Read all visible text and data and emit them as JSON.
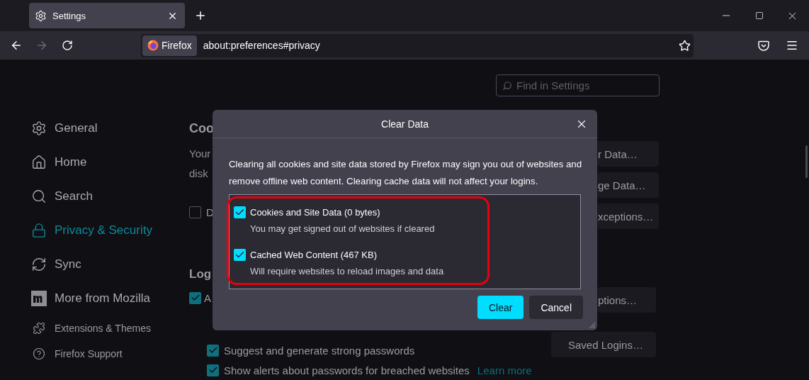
{
  "tab": {
    "title": "Settings",
    "selected": true
  },
  "address_bar": {
    "identity": "Firefox",
    "url": "about:preferences#privacy"
  },
  "search": {
    "placeholder": "Find in Settings"
  },
  "sidebar": {
    "items": [
      {
        "label": "General",
        "kind": "gear",
        "selected": false
      },
      {
        "label": "Home",
        "kind": "home",
        "selected": false
      },
      {
        "label": "Search",
        "kind": "search",
        "selected": false
      },
      {
        "label": "Privacy & Security",
        "kind": "lock",
        "selected": true
      },
      {
        "label": "Sync",
        "kind": "sync",
        "selected": false
      },
      {
        "label": "More from Mozilla",
        "kind": "mozilla",
        "selected": false
      }
    ],
    "footer_items": [
      {
        "label": "Extensions & Themes",
        "kind": "puzzle"
      },
      {
        "label": "Firefox Support",
        "kind": "help"
      }
    ]
  },
  "cookies_section": {
    "heading": "Coo",
    "lines": [
      "Your",
      "disk"
    ],
    "checkbox": {
      "label": "D",
      "checked": false
    },
    "buttons": [
      "r Data…",
      "ge Data…",
      "xceptions…"
    ]
  },
  "logins_section": {
    "heading": "Log",
    "checkbox": {
      "label": "A",
      "checked": true
    },
    "options": [
      {
        "label": "Suggest and generate strong passwords",
        "checked": true
      },
      {
        "label": "Show alerts about passwords for breached websites",
        "checked": true,
        "link": "Learn more"
      }
    ],
    "buttons": [
      "ptions…",
      "Saved Logins…"
    ]
  },
  "dialog": {
    "title": "Clear Data",
    "message": "Clearing all cookies and site data stored by Firefox may sign you out of websites and remove offline web content. Clearing cache data will not affect your logins.",
    "highlighted": true,
    "options": [
      {
        "label": "Cookies and Site Data (0 bytes)",
        "description": "You may get signed out of websites if cleared",
        "checked": true
      },
      {
        "label": "Cached Web Content (467 KB)",
        "description": "Will require websites to reload images and data",
        "checked": true
      }
    ],
    "buttons": [
      {
        "label": "Clear",
        "kind": "primary"
      },
      {
        "label": "Cancel",
        "kind": "secondary"
      }
    ]
  }
}
